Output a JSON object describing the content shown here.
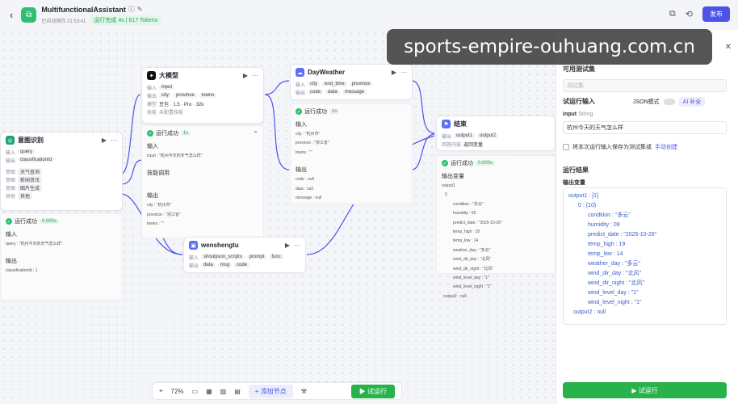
{
  "header": {
    "title": "MultifunctionalAssistant",
    "autosave": "已自动保存 21:53:41",
    "run_badge": "运行完成 4s | 617 Tokens",
    "publish": "发布"
  },
  "nodes": {
    "intent": {
      "name": "意图识别",
      "in_label": "输入",
      "in_chip": "query",
      "out_label": "输出",
      "out_chip": "classificationId",
      "opts": [
        "天气查询",
        "新闻资讯",
        "图片生成",
        "其他"
      ],
      "opt_labels": [
        "意图",
        "意图",
        "意图",
        "其他"
      ],
      "run": "运行成功",
      "time": "0.000s",
      "in_title": "输入",
      "query_line": "query : \"杭州今天的天气怎么样\"",
      "out_title": "输出",
      "out_line": "classificationId : 1"
    },
    "llm": {
      "name": "大模型",
      "in_label": "输入",
      "in_chip": "input",
      "out_label": "输出",
      "out_chips": [
        "city",
        "province",
        "towns"
      ],
      "model_label": "模型",
      "model": "豆包 · 1.5 · Pro · 32k",
      "skill_label": "技能",
      "skill": "未配置技能",
      "run": "运行成功",
      "time": "1s",
      "in_title": "输入",
      "in_line": "input : \"杭州今天的天气怎么样\"",
      "skill_title": "技能调用",
      "out_title": "输出",
      "out_lines": [
        "city : \"杭州市\"",
        "province : \"浙江省\"",
        "towns : \"\""
      ]
    },
    "weather": {
      "name": "DayWeather",
      "in_label": "输入",
      "in_chips": [
        "city",
        "end_time",
        "province"
      ],
      "out_label": "输出",
      "out_chips": [
        "code",
        "data",
        "message"
      ],
      "run": "运行成功",
      "time": "1s",
      "in_title": "输入",
      "in_lines": [
        "city : \"杭州市\"",
        "province : \"浙江省\"",
        "towns : \"\""
      ],
      "out_title": "输出",
      "out_lines": [
        "code : null",
        "data : null",
        "message : null"
      ]
    },
    "wens": {
      "name": "wenshengtu",
      "in_label": "输入",
      "in_chips": [
        "shoulyson_scripts",
        "prompt",
        "func"
      ],
      "out_label": "输出",
      "out_chips": [
        "data",
        "msg",
        "code"
      ]
    },
    "end": {
      "name": "结束",
      "out_label": "输出",
      "out_chips": [
        "output1",
        "output2"
      ],
      "ret_label": "回答内容",
      "ret": "返回变量",
      "run": "运行成功",
      "time": "0.000s",
      "out_title": "输出变量",
      "lines": [
        "output1",
        "0",
        "condition : \"多云\"",
        "humidity : 05",
        "predict_date : \"2025-10-26\"",
        "temp_high : 18",
        "temp_low : 14",
        "weather_day : \"多云\"",
        "wind_dir_day : \"北风\"",
        "wind_dir_night : \"北风\"",
        "wind_level_day : \"1\"",
        "wind_level_night : \"1\"",
        "output2 : null"
      ]
    }
  },
  "panel": {
    "testset_label": "可用测试集",
    "testset_ph": "测试集",
    "input_title": "试运行输入",
    "json_label": "JSON模式",
    "ai_label": "AI 补全",
    "field_name": "input",
    "field_type": "String",
    "field_value": "杭州今天的天气怎么样",
    "save_label": "将本次运行输入保存为测试集或",
    "save_link": "手动创建",
    "result_title": "运行结果",
    "out_title": "输出变量",
    "res_lines": [
      {
        "t": "output1 : [1]",
        "i": 0
      },
      {
        "t": "0 : {10}",
        "i": 1
      },
      {
        "t": "condition : \"多云\"",
        "i": 2
      },
      {
        "t": "humidity : 09",
        "i": 2
      },
      {
        "t": "predict_date : \"2025-10-26\"",
        "i": 2
      },
      {
        "t": "temp_high : 19",
        "i": 2
      },
      {
        "t": "temp_low : 14",
        "i": 2
      },
      {
        "t": "weather_day : \"多云\"",
        "i": 2
      },
      {
        "t": "wind_dir_day : \"北风\"",
        "i": 2
      },
      {
        "t": "wind_dir_night : \"北风\"",
        "i": 2
      },
      {
        "t": "wind_level_day : \"1\"",
        "i": 2
      },
      {
        "t": "wind_level_night : \"1\"",
        "i": 2
      },
      {
        "t": "output2 : null",
        "i": 0.5
      }
    ],
    "run_btn": "试运行"
  },
  "toolbar": {
    "zoom": "72%",
    "add_node": "添加节点",
    "run": "试运行"
  },
  "watermark": "sports-empire-ouhuang.com.cn"
}
